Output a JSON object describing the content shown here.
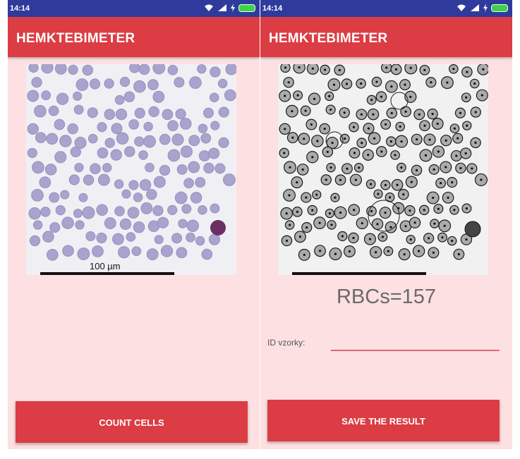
{
  "colors": {
    "statusbar": "#2f3b9c",
    "appbar": "#dc3c44",
    "background": "#fde0e1",
    "button": "#dc3c44",
    "input_underline": "#e2667a"
  },
  "left_screen": {
    "status_time": "14:14",
    "app_title": "HEMKTEBIMETER",
    "scale_label": "100 µm",
    "button_label": "COUNT CELLS"
  },
  "right_screen": {
    "status_time": "14:14",
    "app_title": "HEMKTEBIMETER",
    "result_text": "RBCs=157",
    "id_label": "ID vzorky:",
    "id_value": "",
    "button_label": "SAVE THE RESULT"
  },
  "icons": [
    "wifi-icon",
    "signal-icon",
    "charging-icon",
    "battery-icon"
  ]
}
